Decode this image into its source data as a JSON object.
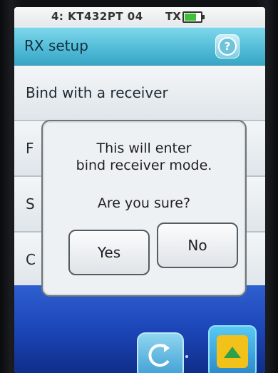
{
  "status_bar": {
    "model_text": "4: KT432PT 04",
    "tx_label": "TX"
  },
  "header": {
    "title": "RX setup",
    "help_icon": "help-icon"
  },
  "list": {
    "items": [
      {
        "label": "Bind with a receiver"
      },
      {
        "label": "F"
      },
      {
        "label": "S"
      },
      {
        "label": "C"
      }
    ]
  },
  "dialog": {
    "message_line1": "This will enter",
    "message_line2": "bind receiver mode.",
    "question": "Are you sure?",
    "yes_label": "Yes",
    "no_label": "No"
  },
  "bottom_nav": {
    "back_icon": "back-arrow-icon",
    "forward_icon": "forward-arrow-icon"
  },
  "colors": {
    "title_bar": "#4fb9d6",
    "battery": "#3fbf3a",
    "background_blue": "#1c46b8"
  }
}
